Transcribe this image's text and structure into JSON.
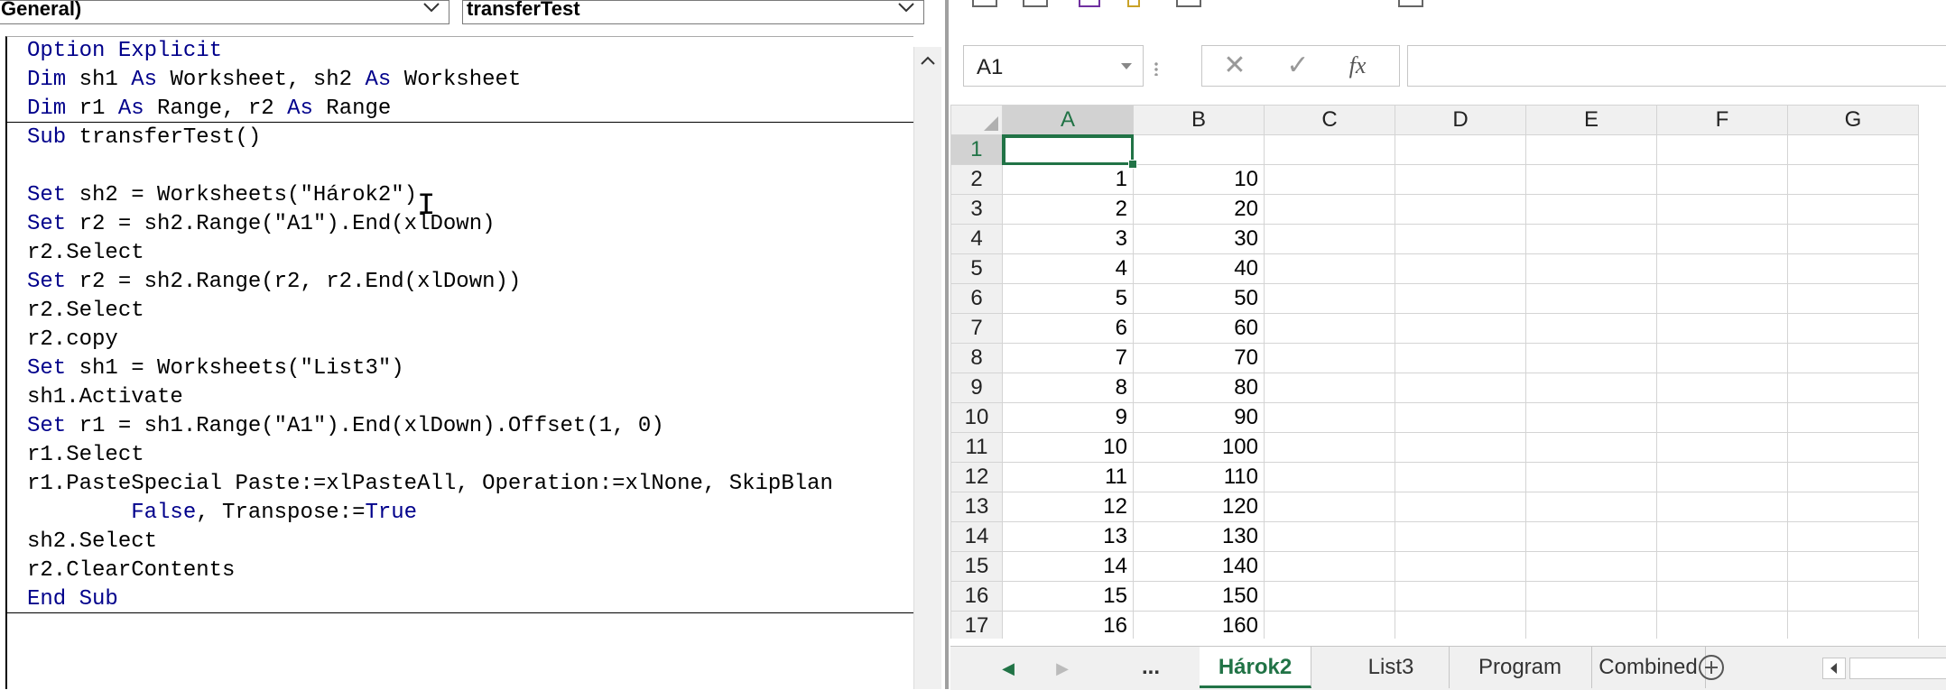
{
  "vba": {
    "object_combo": "General)",
    "procedure_combo": "transferTest",
    "code_lines": [
      [
        {
          "t": "Option Explicit",
          "k": true
        }
      ],
      [
        {
          "t": "Dim",
          "k": true
        },
        {
          "t": " sh1 "
        },
        {
          "t": "As",
          "k": true
        },
        {
          "t": " Worksheet, sh2 "
        },
        {
          "t": "As",
          "k": true
        },
        {
          "t": " Worksheet"
        }
      ],
      [
        {
          "t": "Dim",
          "k": true
        },
        {
          "t": " r1 "
        },
        {
          "t": "As",
          "k": true
        },
        {
          "t": " Range, r2 "
        },
        {
          "t": "As",
          "k": true
        },
        {
          "t": " Range"
        }
      ],
      [
        {
          "t": "Sub",
          "k": true
        },
        {
          "t": " transferTest()"
        }
      ],
      [
        {
          "t": ""
        }
      ],
      [
        {
          "t": "Set",
          "k": true
        },
        {
          "t": " sh2 = Worksheets(\"Hárok2\")"
        }
      ],
      [
        {
          "t": "Set",
          "k": true
        },
        {
          "t": " r2 = sh2.Range(\"A1\").End(xlDown)"
        }
      ],
      [
        {
          "t": "r2.Select"
        }
      ],
      [
        {
          "t": "Set",
          "k": true
        },
        {
          "t": " r2 = sh2.Range(r2, r2.End(xlDown))"
        }
      ],
      [
        {
          "t": "r2.Select"
        }
      ],
      [
        {
          "t": "r2.copy"
        }
      ],
      [
        {
          "t": "Set",
          "k": true
        },
        {
          "t": " sh1 = Worksheets(\"List3\")"
        }
      ],
      [
        {
          "t": "sh1.Activate"
        }
      ],
      [
        {
          "t": "Set",
          "k": true
        },
        {
          "t": " r1 = sh1.Range(\"A1\").End(xlDown).Offset(1, 0)"
        }
      ],
      [
        {
          "t": "r1.Select"
        }
      ],
      [
        {
          "t": "r1.PasteSpecial Paste:=xlPasteAll, Operation:=xlNone, SkipBlan"
        }
      ],
      [
        {
          "t": "        "
        },
        {
          "t": "False",
          "k": true
        },
        {
          "t": ", Transpose:="
        },
        {
          "t": "True",
          "k": true
        }
      ],
      [
        {
          "t": "sh2.Select"
        }
      ],
      [
        {
          "t": "r2.ClearContents"
        }
      ],
      [
        {
          "t": "End Sub",
          "k": true
        }
      ]
    ]
  },
  "excel": {
    "name_box": "A1",
    "formula_buttons": {
      "cancel": "✕",
      "enter": "✓",
      "fx": "fx"
    },
    "formula_value": "",
    "columns": [
      "A",
      "B",
      "C",
      "D",
      "E",
      "F",
      "G"
    ],
    "active_column": "A",
    "active_row": 1,
    "rows": [
      {
        "n": "1",
        "a": "",
        "b": ""
      },
      {
        "n": "2",
        "a": "1",
        "b": "10"
      },
      {
        "n": "3",
        "a": "2",
        "b": "20"
      },
      {
        "n": "4",
        "a": "3",
        "b": "30"
      },
      {
        "n": "5",
        "a": "4",
        "b": "40"
      },
      {
        "n": "6",
        "a": "5",
        "b": "50"
      },
      {
        "n": "7",
        "a": "6",
        "b": "60"
      },
      {
        "n": "8",
        "a": "7",
        "b": "70"
      },
      {
        "n": "9",
        "a": "8",
        "b": "80"
      },
      {
        "n": "10",
        "a": "9",
        "b": "90"
      },
      {
        "n": "11",
        "a": "10",
        "b": "100"
      },
      {
        "n": "12",
        "a": "11",
        "b": "110"
      },
      {
        "n": "13",
        "a": "12",
        "b": "120"
      },
      {
        "n": "14",
        "a": "13",
        "b": "130"
      },
      {
        "n": "15",
        "a": "14",
        "b": "140"
      },
      {
        "n": "16",
        "a": "15",
        "b": "150"
      },
      {
        "n": "17",
        "a": "16",
        "b": "160"
      }
    ],
    "tabs": {
      "ellipsis": "...",
      "items": [
        "Hárok2",
        "List3",
        "Program",
        "Combined"
      ],
      "active": "Hárok2"
    },
    "colors": {
      "accent": "#217346",
      "keyword": "#00008b"
    }
  }
}
